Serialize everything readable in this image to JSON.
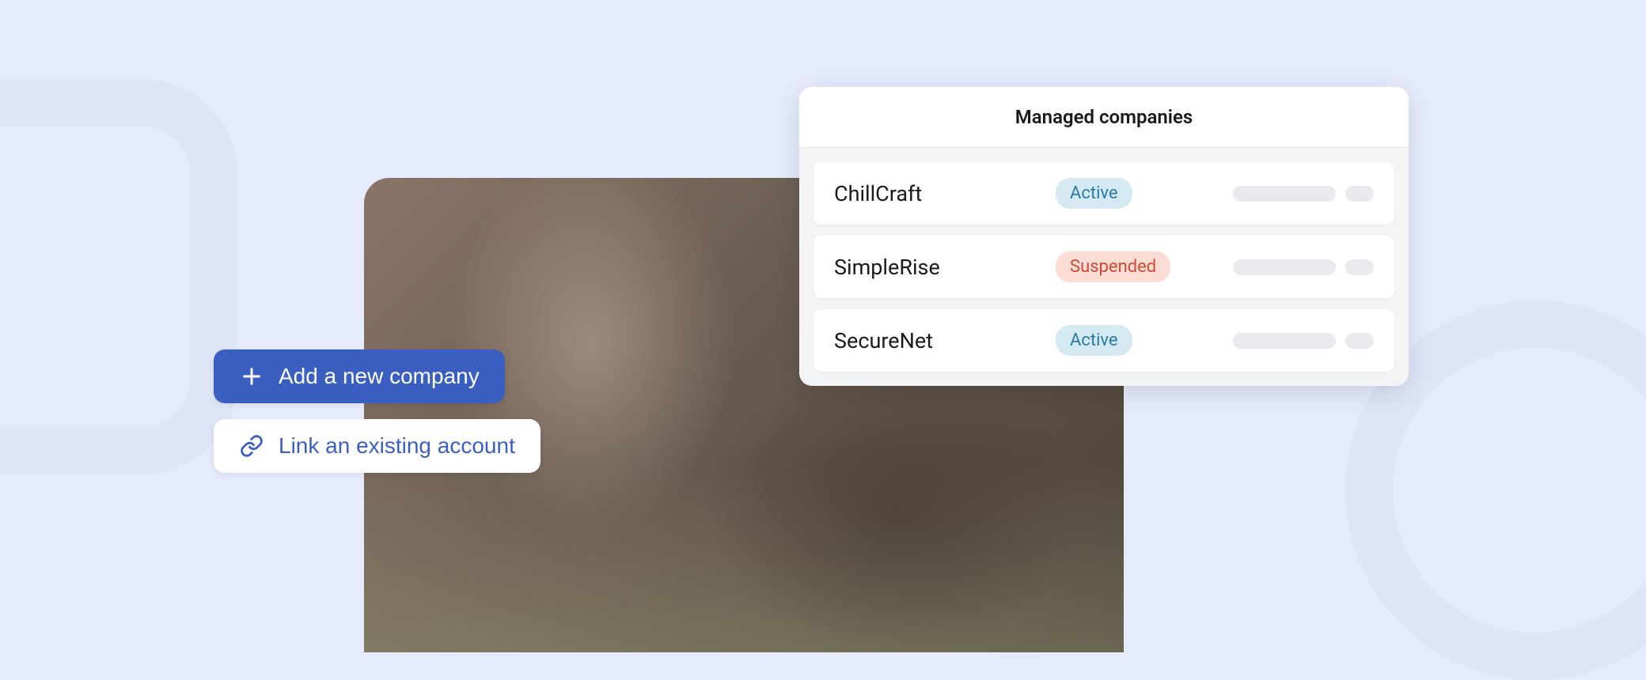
{
  "buttons": {
    "add_company": "Add a new company",
    "link_account": "Link an existing account"
  },
  "panel": {
    "title": "Managed companies",
    "companies": [
      {
        "name": "ChillCraft",
        "status": "Active",
        "status_class": "active"
      },
      {
        "name": "SimpleRise",
        "status": "Suspended",
        "status_class": "suspended"
      },
      {
        "name": "SecureNet",
        "status": "Active",
        "status_class": "active"
      }
    ]
  },
  "colors": {
    "background": "#e5ebfa",
    "primary": "#3b5fc0",
    "active_bg": "#d4e9f2",
    "active_fg": "#2a7ca8",
    "suspended_bg": "#fddcd4",
    "suspended_fg": "#d04a35"
  }
}
